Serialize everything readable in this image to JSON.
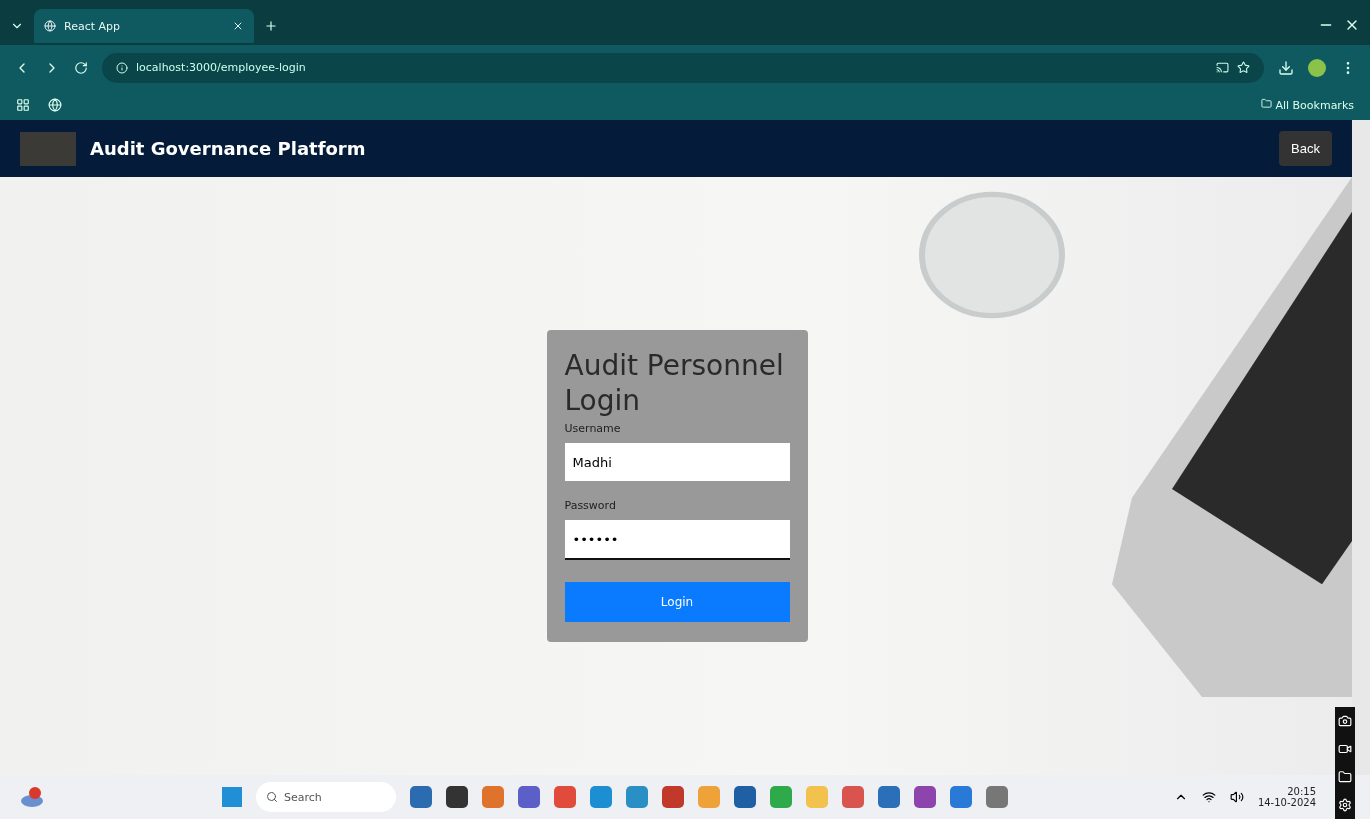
{
  "browser": {
    "tab": {
      "title": "React App",
      "selected": true
    },
    "url": "localhost:3000/employee-login",
    "bookmarks_label": "All Bookmarks"
  },
  "header": {
    "title": "Audit Governance Platform",
    "back_button": "Back"
  },
  "login": {
    "title": "Audit Personnel Login",
    "fields": [
      {
        "label": "Username",
        "value": "Madhi",
        "kind": "text"
      },
      {
        "label": "Password",
        "value": "••••••",
        "kind": "password"
      }
    ],
    "button": "Login"
  },
  "taskbar": {
    "search_placeholder": "Search",
    "clock": {
      "time": "20:15",
      "date": "14-10-2024"
    }
  }
}
